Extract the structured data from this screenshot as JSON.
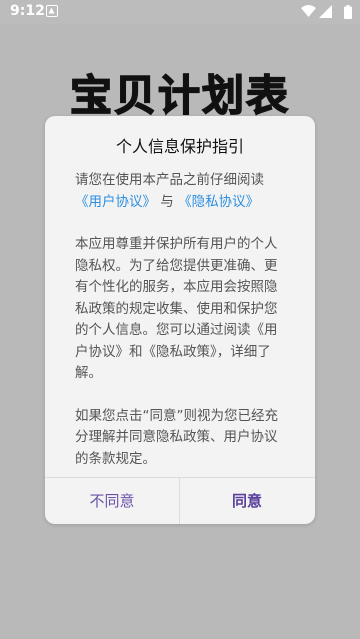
{
  "status_bar": {
    "time": "9:12"
  },
  "app": {
    "title": "宝贝计划表"
  },
  "dialog": {
    "title": "个人信息保护指引",
    "intro_text": "请您在使用本产品之前仔细阅读",
    "user_agreement_link": "《用户协议》",
    "and_text": "与",
    "privacy_policy_link": "《隐私协议》",
    "paragraph_2": "本应用尊重并保护所有用户的个人隐私权。为了给您提供更准确、更有个性化的服务，本应用会按照隐私政策的规定收集、使用和保护您的个人信息。您可以通过阅读《用户协议》和《隐私政策》，详细了解。",
    "paragraph_3": "如果您点击“同意”则视为您已经充分理解并同意隐私政策、用户协议的条款规定。",
    "disagree_label": "不同意",
    "agree_label": "同意"
  },
  "colors": {
    "overlay_background": "#b9b9b9",
    "link": "#2d8fe0",
    "button_text": "#5a3f9c"
  }
}
